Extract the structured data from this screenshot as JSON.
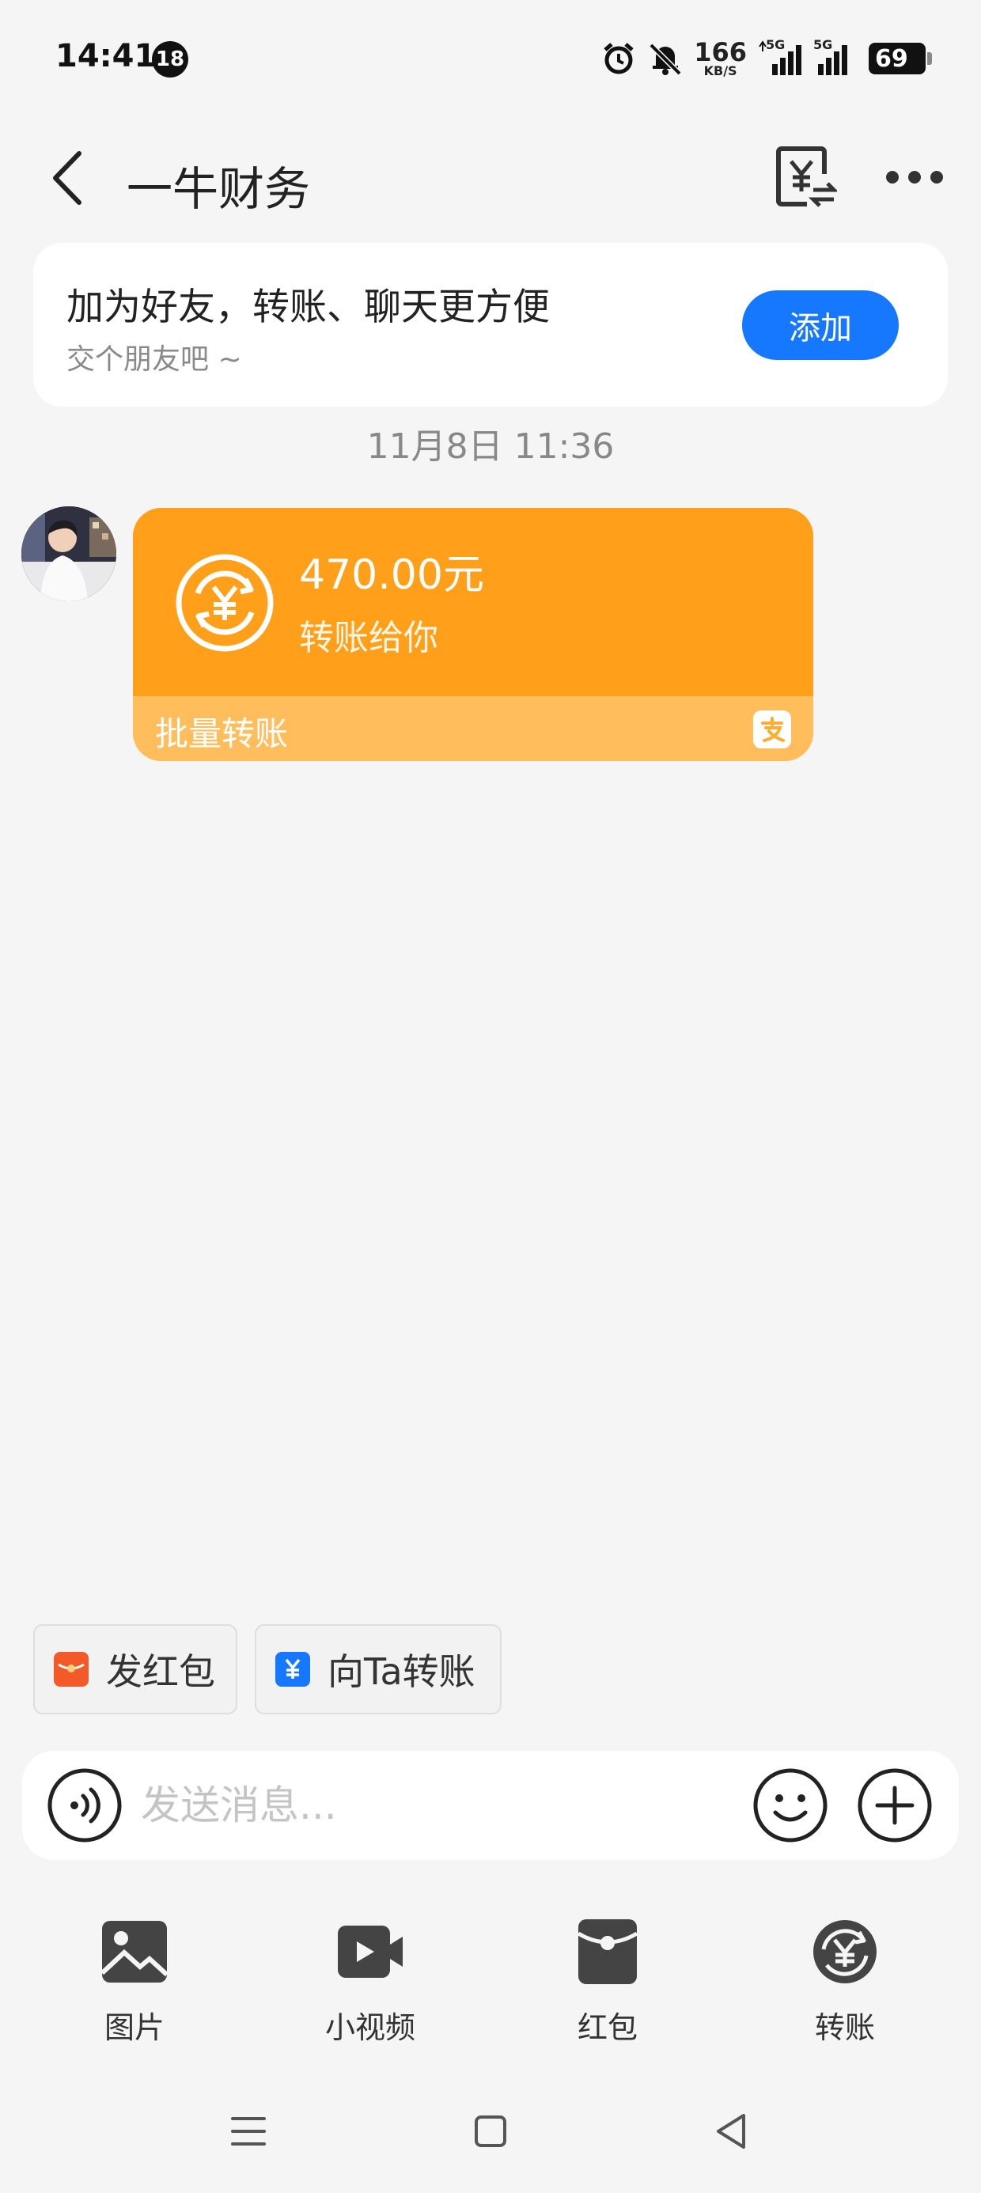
{
  "status_bar": {
    "time": "14:41",
    "notification_count": "18",
    "net_speed_value": "166",
    "net_speed_unit": "KB/S",
    "signal_1_label": "5G",
    "signal_2_label": "5G",
    "battery": "69"
  },
  "header": {
    "title": "一牛财务",
    "icons": [
      "back-icon",
      "transfer-record-icon",
      "more-icon"
    ]
  },
  "friend_banner": {
    "title": "加为好友，转账、聊天更方便",
    "subtitle": "交个朋友吧 ~",
    "add_label": "添加"
  },
  "timestamp": "11月8日 11:36",
  "message": {
    "amount": "470.00元",
    "description": "转账给你",
    "footer": "批量转账",
    "card_color": "#ff9f1a",
    "footer_color": "#ffbd5c"
  },
  "quick_actions": {
    "red_packet": "发红包",
    "transfer": "向Ta转账"
  },
  "input": {
    "placeholder": "发送消息..."
  },
  "tools": {
    "photo": "图片",
    "video": "小视频",
    "red_packet": "红包",
    "transfer": "转账"
  },
  "colors": {
    "accent_blue": "#1677ff",
    "red_packet": "#f25a29"
  }
}
